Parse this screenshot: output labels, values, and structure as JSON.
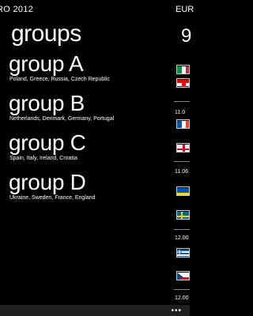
{
  "header": {
    "app_title": "RO 2012",
    "next_title": "EUR"
  },
  "panorama": {
    "title": "groups"
  },
  "groups": [
    {
      "name": "group A",
      "teams": "Poland, Greece, Russia, Czech Republic"
    },
    {
      "name": "group B",
      "teams": "Netherlands, Denmark, Germany, Portugal"
    },
    {
      "name": "group C",
      "teams": "Spain, Italy, Ireland, Croatia"
    },
    {
      "name": "group D",
      "teams": "Ukraine, Sweden, France, England"
    }
  ],
  "peek": {
    "big_glyph": "9",
    "dates": [
      "11.0",
      "11.06",
      "12.00",
      "12.00"
    ],
    "flags": [
      {
        "name": "italy-flag-icon",
        "colors": [
          "#009246",
          "#ffffff",
          "#ce2b37"
        ],
        "layout": "vertical"
      },
      {
        "name": "croatia-flag-icon",
        "colors": [
          "#ff0000",
          "#ffffff",
          "#171796"
        ],
        "layout": "horizontal"
      },
      {
        "name": "england-flag-icon",
        "colors": [
          "#ffffff",
          "#cf081f"
        ],
        "layout": "cross"
      },
      {
        "name": "france-flag-icon",
        "colors": [
          "#0055a4",
          "#ffffff",
          "#ef4135"
        ],
        "layout": "vertical"
      },
      {
        "name": "ukraine-flag-icon",
        "colors": [
          "#0057b7",
          "#ffd700"
        ],
        "layout": "horizontal"
      },
      {
        "name": "sweden-flag-icon",
        "colors": [
          "#006aa7",
          "#fecc00"
        ],
        "layout": "nordic"
      },
      {
        "name": "greece-flag-icon",
        "colors": [
          "#0d5eaf",
          "#ffffff"
        ],
        "layout": "stripes"
      },
      {
        "name": "czech-flag-icon",
        "colors": [
          "#ffffff",
          "#d7141a",
          "#11457e"
        ],
        "layout": "czech"
      }
    ]
  },
  "appbar": {
    "more_label": "•••"
  }
}
